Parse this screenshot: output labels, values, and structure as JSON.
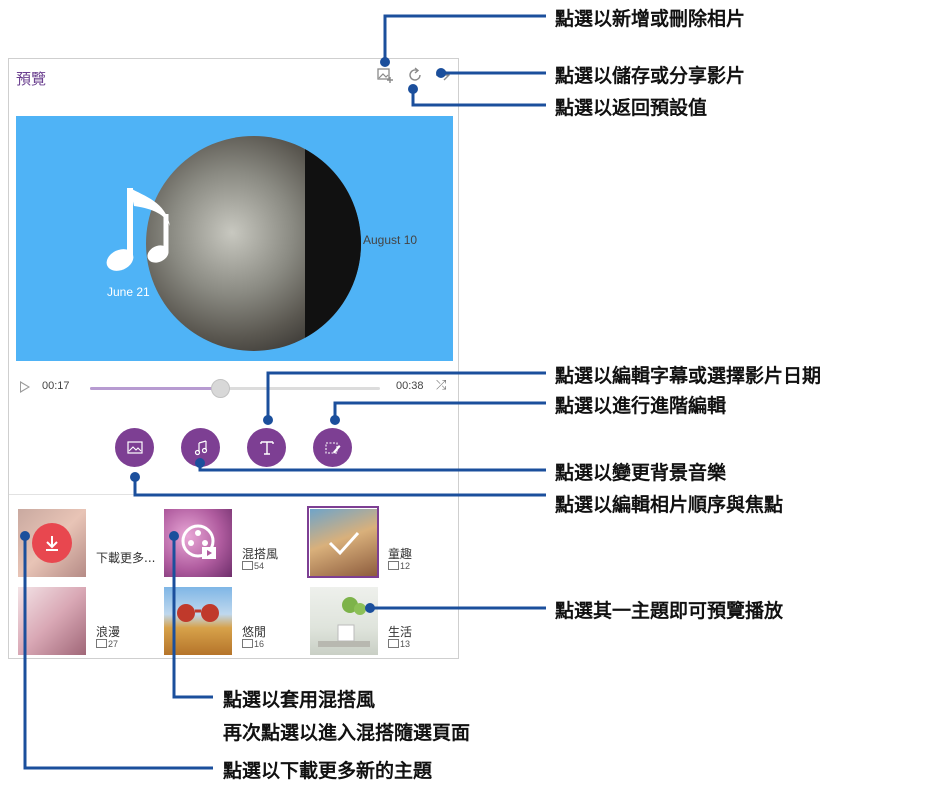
{
  "app": {
    "title": "預覽"
  },
  "preview": {
    "date_left": "June 21",
    "date_right": "August 10"
  },
  "player": {
    "current_time": "00:17",
    "total_time": "00:38",
    "progress": 0.45
  },
  "colors": {
    "accent": "#7d3f93",
    "preview_bg": "#4fb3f6",
    "callout_line": "#1b4f9c"
  },
  "edit_buttons": [
    {
      "icon": "photo-order-icon"
    },
    {
      "icon": "music-note-icon"
    },
    {
      "icon": "text-caption-icon"
    },
    {
      "icon": "advanced-edit-icon"
    }
  ],
  "themes": [
    {
      "name": "下載更多...",
      "count": ""
    },
    {
      "name": "混搭風",
      "count": "54"
    },
    {
      "name": "童趣",
      "count": "12"
    },
    {
      "name": "浪漫",
      "count": "27"
    },
    {
      "name": "悠閒",
      "count": "16"
    },
    {
      "name": "生活",
      "count": "13"
    }
  ],
  "callouts": {
    "add_delete": "點選以新增或刪除相片",
    "save_share": "點選以儲存或分享影片",
    "reset": "點選以返回預設值",
    "caption_date": "點選以編輯字幕或選擇影片日期",
    "advanced": "點選以進行進階編輯",
    "music": "點選以變更背景音樂",
    "order_focus": "點選以編輯相片順序與焦點",
    "theme_preview": "點選其一主題即可預覽播放",
    "mix_line1": "點選以套用混搭風",
    "mix_line2": "再次點選以進入混搭隨選頁面",
    "download": "點選以下載更多新的主題"
  }
}
